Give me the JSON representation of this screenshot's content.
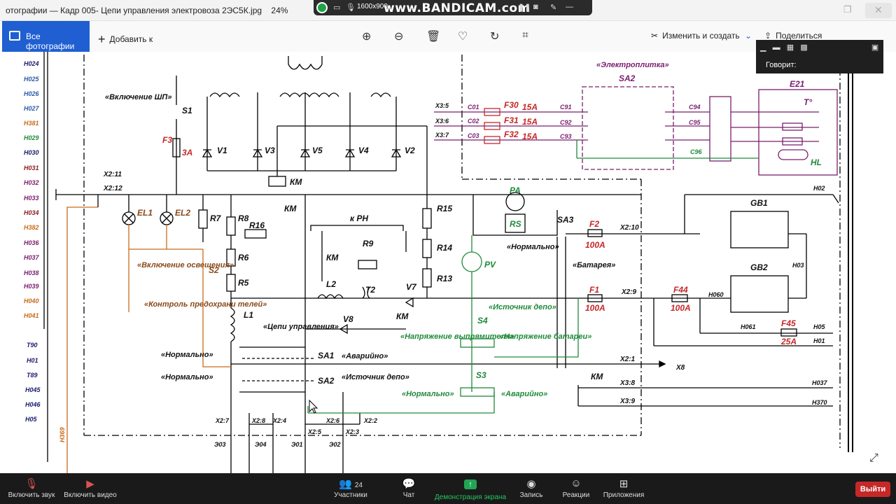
{
  "window": {
    "title": "отографии — Кадр 005- Цепи управления электровоза 2ЭС5К.jpg",
    "zoom": "24%",
    "recorder": {
      "resolution": "1600x900",
      "brand": "www.BANDICAM.com"
    }
  },
  "toolbar": {
    "all_photos": "Все фотографии",
    "add_to": "Добавить к",
    "edit_create": "Изменить и создать",
    "share": "Поделиться",
    "icons": [
      "zoom-in-icon",
      "zoom-out-icon",
      "delete-icon",
      "heart-icon",
      "rotate-icon",
      "crop-icon"
    ]
  },
  "speaking_popup": {
    "label": "Говорит:"
  },
  "schematic": {
    "wire_labels_left": [
      "Н024",
      "Н025",
      "Н026",
      "Н027",
      "Н381",
      "Н029",
      "Н030",
      "Н031",
      "Н032",
      "Н033",
      "Н034",
      "Н382",
      "Н036",
      "Н037",
      "Н038",
      "Н039",
      "Н040",
      "Н041"
    ],
    "wire_labels_left_lower": [
      "Т90",
      "Н01",
      "Т89",
      "Н045",
      "Н046",
      "Н05"
    ],
    "wire_vertical": "Н369",
    "components": {
      "s1_caption": "«Включение ШП»",
      "s1": "S1",
      "f3": "F3",
      "f3_rating": "3А",
      "v1": "V1",
      "v3": "V3",
      "v5": "V5",
      "v4": "V4",
      "v2": "V2",
      "km": "КМ",
      "x2_11": "Х2:11",
      "x2_12": "Х2:12",
      "el1": "EL1",
      "el2": "EL2",
      "r7": "R7",
      "r8": "R8",
      "r16": "R16",
      "r6": "R6",
      "r5": "R5",
      "k_rn": "к РН",
      "r9": "R9",
      "t2": "Т2",
      "l2": "L2",
      "v7": "V7",
      "v8": "V8",
      "r15": "R15",
      "r14": "R14",
      "r13": "R13",
      "l1": "L1",
      "s2": "S2",
      "s2_caption": "«Включение освещения»",
      "control_caption": "«Контроль предохрани телей»",
      "circuits_caption": "«Цепи управления»",
      "normal": "«Нормально»",
      "sa1": "SA1",
      "sa2": "SA2",
      "emergency": "«Аварийно»",
      "depot_source": "«Источник депо»",
      "pa": "PA",
      "rs": "RS",
      "pv": "PV",
      "sa3": "SA3",
      "battery_caption": "«Батарея»",
      "s4": "S4",
      "s3": "S3",
      "rect_voltage": "«Напряжение выпрямителя»",
      "bat_voltage": "«Напряжение батареи»",
      "f2": "F2",
      "f2_rating": "100А",
      "f1": "F1",
      "f1_rating": "100А",
      "f44": "F44",
      "f44_rating": "100А",
      "f45": "F45",
      "f45_rating": "25А",
      "gb1": "GB1",
      "gb2": "GB2",
      "x2_10": "Х2:10",
      "x2_9": "Х2:9",
      "x2_1": "Х2:1",
      "x3_8": "Х3:8",
      "x3_9": "Х3:9",
      "x8": "Х8",
      "h060": "Н060",
      "h061": "Н061",
      "h03": "Н03",
      "h02": "Н02",
      "h05": "Н05",
      "h01": "Н01",
      "h037": "Н037",
      "h370": "Н370",
      "x2_7": "Х2:7",
      "x2_8": "Х2:8",
      "x2_4": "Х2:4",
      "x2_6": "Х2:6",
      "x2_2": "Х2:2",
      "x2_5": "Х2:5",
      "x2_3": "Х2:3",
      "e03": "Э03",
      "e04": "Э04",
      "e01": "Э01",
      "e02": "Э02",
      "stove_caption": "«Электроплитка»",
      "sa2_stove": "SA2",
      "x3_5": "Х3:5",
      "x3_6": "Х3:6",
      "x3_7": "Х3:7",
      "c01": "С01",
      "c02": "С02",
      "c03": "С03",
      "f30": "F30",
      "f31": "F31",
      "f32": "F32",
      "stove_rating": "15А",
      "c91": "С91",
      "c92": "С92",
      "c93": "С93",
      "c94": "С94",
      "c95": "С95",
      "c96": "С96",
      "e21": "Е21",
      "t_deg": "Т°",
      "hl": "HL"
    }
  },
  "zoom_bar": {
    "mute": "Включить звук",
    "video": "Включить видео",
    "participants": "Участники",
    "participants_count": "24",
    "chat": "Чат",
    "share_screen": "Демонстрация экрана",
    "record": "Запись",
    "reactions": "Реакции",
    "apps": "Приложения",
    "exit": "Выйти"
  }
}
